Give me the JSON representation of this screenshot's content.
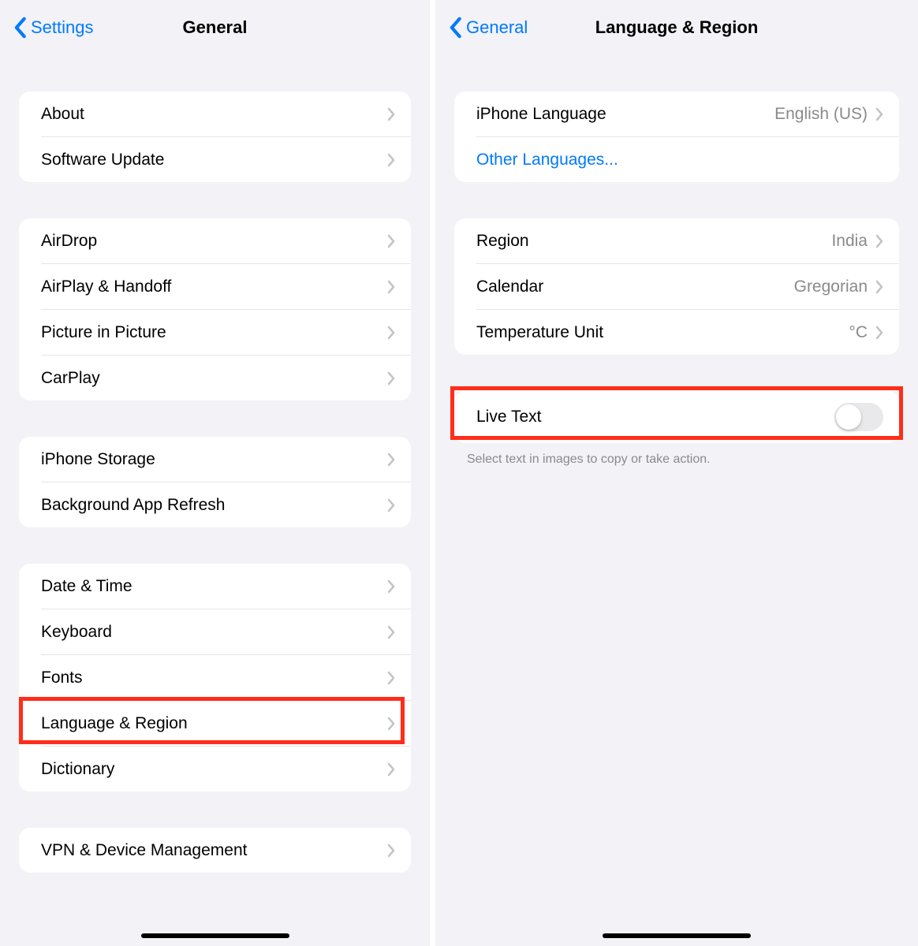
{
  "left": {
    "nav": {
      "back": "Settings",
      "title": "General"
    },
    "groups": [
      {
        "rows": [
          {
            "id": "about",
            "label": "About"
          },
          {
            "id": "software-update",
            "label": "Software Update"
          }
        ]
      },
      {
        "rows": [
          {
            "id": "airdrop",
            "label": "AirDrop"
          },
          {
            "id": "airplay-handoff",
            "label": "AirPlay & Handoff"
          },
          {
            "id": "picture-in-picture",
            "label": "Picture in Picture"
          },
          {
            "id": "carplay",
            "label": "CarPlay"
          }
        ]
      },
      {
        "rows": [
          {
            "id": "iphone-storage",
            "label": "iPhone Storage"
          },
          {
            "id": "background-app-refresh",
            "label": "Background App Refresh"
          }
        ]
      },
      {
        "rows": [
          {
            "id": "date-time",
            "label": "Date & Time"
          },
          {
            "id": "keyboard",
            "label": "Keyboard"
          },
          {
            "id": "fonts",
            "label": "Fonts"
          },
          {
            "id": "language-region",
            "label": "Language & Region",
            "highlight": true
          },
          {
            "id": "dictionary",
            "label": "Dictionary"
          }
        ]
      },
      {
        "rows": [
          {
            "id": "vpn-device-management",
            "label": "VPN & Device Management"
          }
        ]
      }
    ]
  },
  "right": {
    "nav": {
      "back": "General",
      "title": "Language & Region"
    },
    "lang": {
      "iphone_language_label": "iPhone Language",
      "iphone_language_value": "English (US)",
      "other_languages": "Other Languages..."
    },
    "region": {
      "region_label": "Region",
      "region_value": "India",
      "calendar_label": "Calendar",
      "calendar_value": "Gregorian",
      "temp_label": "Temperature Unit",
      "temp_value": "°C"
    },
    "live_text": {
      "label": "Live Text",
      "enabled": false,
      "footer": "Select text in images to copy or take action."
    }
  }
}
